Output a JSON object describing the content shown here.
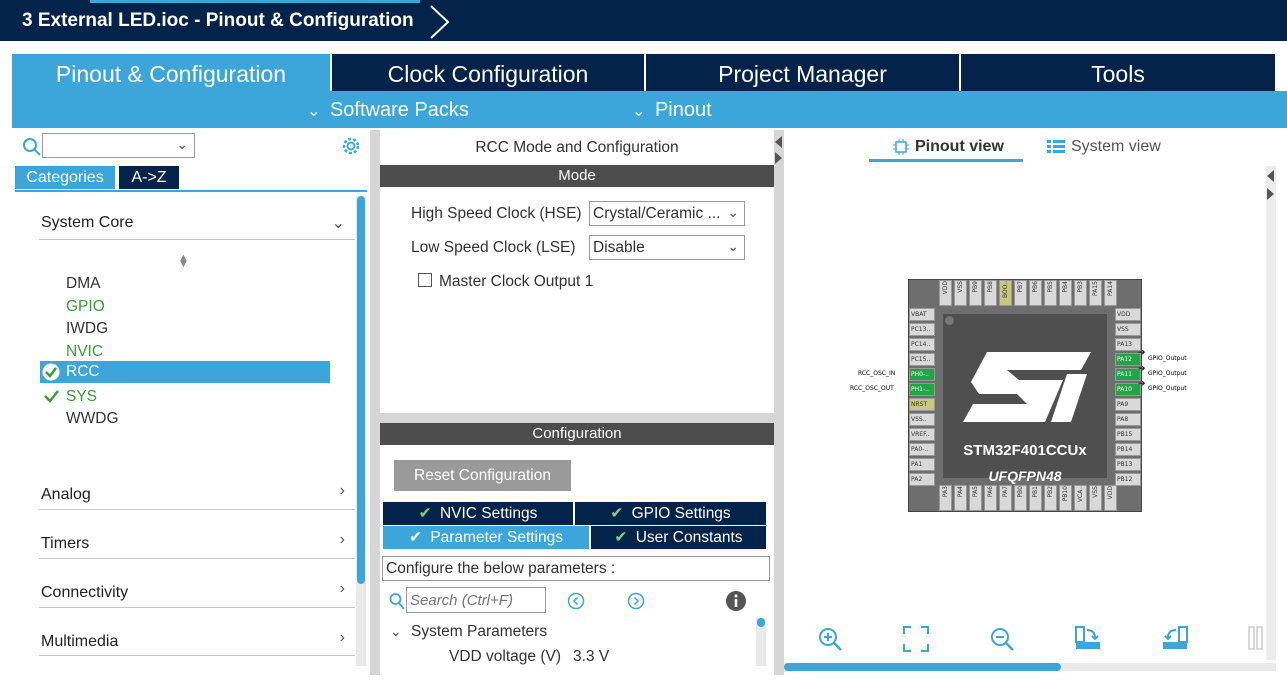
{
  "window": {
    "title": "3 External LED.ioc - Pinout & Configuration"
  },
  "main_tabs": [
    "Pinout & Configuration",
    "Clock Configuration",
    "Project Manager",
    "Tools"
  ],
  "sub_menus": [
    "Software Packs",
    "Pinout"
  ],
  "left": {
    "search_value": "",
    "tab_categories": "Categories",
    "tab_az": "A->Z",
    "categories": {
      "system_core": "System Core",
      "analog": "Analog",
      "timers": "Timers",
      "connectivity": "Connectivity",
      "multimedia": "Multimedia"
    },
    "items": [
      "DMA",
      "GPIO",
      "IWDG",
      "NVIC",
      "RCC",
      "SYS",
      "WWDG"
    ]
  },
  "mid": {
    "title": "RCC Mode and Configuration",
    "mode_header": "Mode",
    "hse_label": "High Speed Clock (HSE)",
    "hse_value": "Crystal/Ceramic ...",
    "lse_label": "Low Speed Clock (LSE)",
    "lse_value": "Disable",
    "mco_label": "Master Clock Output 1",
    "config_header": "Configuration",
    "reset_button": "Reset Configuration",
    "tabs": [
      "NVIC Settings",
      "GPIO Settings",
      "Parameter Settings",
      "User Constants"
    ],
    "configure_text": "Configure the below parameters :",
    "search_placeholder": "Search (Ctrl+F)",
    "group_label": "System Parameters",
    "vdd_label": "VDD voltage (V)",
    "vdd_value": "3.3 V"
  },
  "right": {
    "pinout_view": "Pinout view",
    "system_view": "System view",
    "chip_name": "STM32F401CCUx",
    "package": "UFQFPN48",
    "left_pins": [
      "VBAT",
      "PC13..",
      "PC14..",
      "PC15..",
      "PH0-..",
      "PH1-..",
      "NRST",
      "VSS..",
      "VREF..",
      "PA0-..",
      "PA1",
      "PA2"
    ],
    "right_pins": [
      "VDD",
      "VSS",
      "PA13",
      "PA12",
      "PA11",
      "PA10",
      "PA9",
      "PA8",
      "PB15",
      "PB14",
      "PB13",
      "PB12"
    ],
    "top_pins": [
      "VDD",
      "VSS",
      "PB9",
      "PB8",
      "BOO..",
      "PB7",
      "PB6",
      "PB5",
      "PB4",
      "PB3",
      "PA15",
      "PA14"
    ],
    "bottom_pins": [
      "PA3",
      "PA4",
      "PA5",
      "PA6",
      "PA7",
      "PB0",
      "PB1",
      "PB2",
      "PB10",
      "VCA..",
      "VSS",
      "VDD"
    ],
    "ext_left": [
      "RCC_OSC_IN",
      "RCC_OSC_OUT"
    ],
    "ext_right": [
      "GPIO_Output",
      "GPIO_Output",
      "GPIO_Output"
    ]
  }
}
